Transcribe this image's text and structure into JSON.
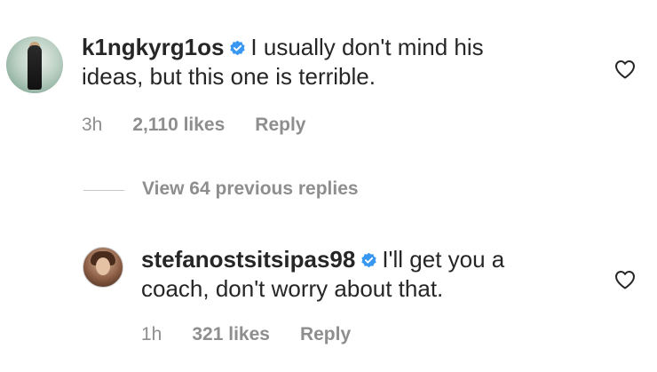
{
  "comments": [
    {
      "username": "k1ngkyrg1os",
      "verified": true,
      "text_line1": "I usually don't mind his",
      "text_line2": "ideas, but this one is terrible.",
      "time": "3h",
      "likes": "2,110 likes",
      "reply_label": "Reply",
      "avatar_icon": "profile-photo"
    },
    {
      "username": "stefanostsitsipas98",
      "verified": true,
      "text_line1": "I'll get you a",
      "text_line2": "coach, don't worry about that.",
      "time": "1h",
      "likes": "321 likes",
      "reply_label": "Reply",
      "avatar_icon": "profile-photo"
    }
  ],
  "replies_toggle": {
    "label": "View 64 previous replies"
  },
  "colors": {
    "text": "#262626",
    "secondary": "#8e8e8e",
    "verified_badge": "#3897f0"
  },
  "icons": {
    "like": "heart-outline-icon",
    "verified": "verified-badge-icon"
  }
}
